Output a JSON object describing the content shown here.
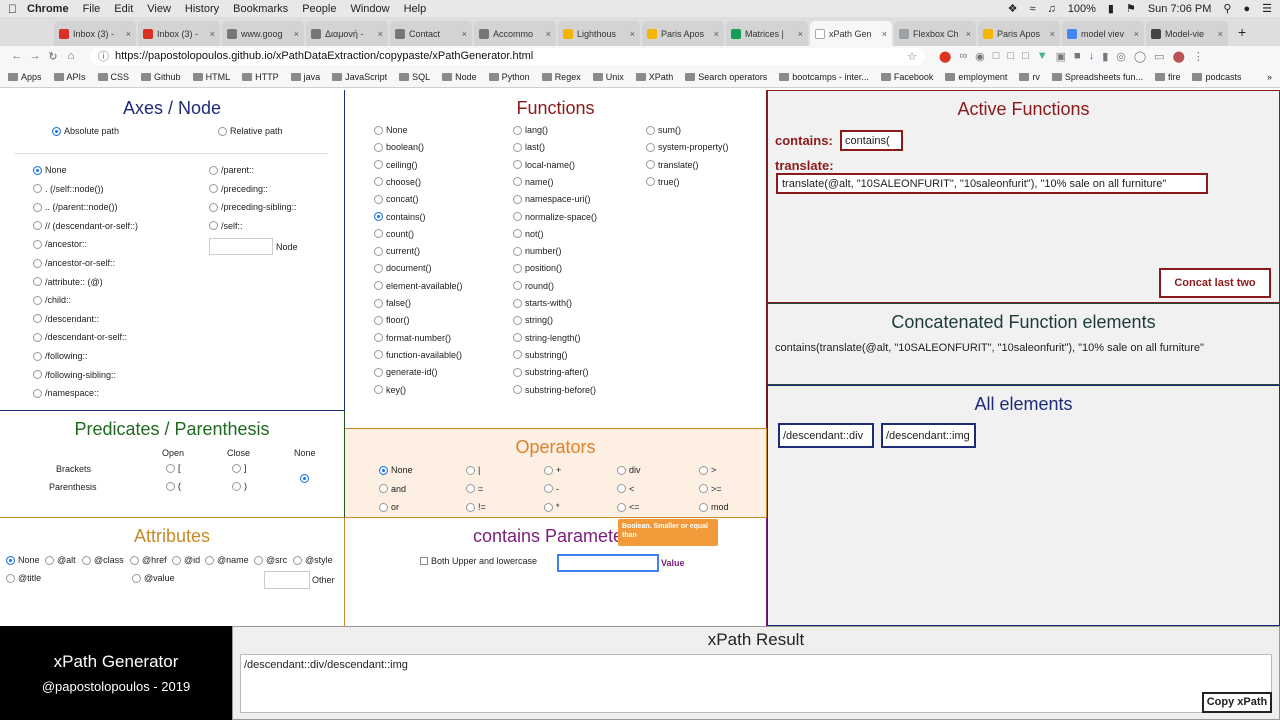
{
  "macbar": {
    "app": "Chrome",
    "menus": [
      "File",
      "Edit",
      "View",
      "History",
      "Bookmarks",
      "People",
      "Window",
      "Help"
    ],
    "battery": "100%",
    "clock": "Sun 7:06 PM"
  },
  "tabs": [
    {
      "label": "Inbox (3) -",
      "color": "#d93025"
    },
    {
      "label": "Inbox (3) -",
      "color": "#d93025"
    },
    {
      "label": "www.goog",
      "color": "#777"
    },
    {
      "label": "Διαμονή - ",
      "color": "#777"
    },
    {
      "label": "Contact",
      "color": "#777"
    },
    {
      "label": "Accommo",
      "color": "#777"
    },
    {
      "label": "Lighthous",
      "color": "#f4b400"
    },
    {
      "label": "Paris Apos",
      "color": "#f4b400"
    },
    {
      "label": "Matrices |",
      "color": "#0f9d58"
    },
    {
      "label": "xPath Gen",
      "color": "#ffffff"
    },
    {
      "label": "Flexbox Ch",
      "color": "#9aa0a6"
    },
    {
      "label": "Paris Apos",
      "color": "#f4b400"
    },
    {
      "label": "model viev",
      "color": "#4285f4"
    },
    {
      "label": "Model-vie",
      "color": "#444"
    }
  ],
  "url": "https://papostolopoulos.github.io/xPathDataExtraction/copypaste/xPathGenerator.html",
  "bookmarks": [
    "Apps",
    "APIs",
    "CSS",
    "Github",
    "HTML",
    "HTTP",
    "java",
    "JavaScript",
    "SQL",
    "Node",
    "Python",
    "Regex",
    "Unix",
    "XPath",
    "Search operators",
    "bootcamps - inter...",
    "Facebook",
    "employment",
    "rv",
    "Spreadsheets fun...",
    "fire",
    "podcasts"
  ],
  "axes": {
    "title": "Axes / Node",
    "abs": "Absolute path",
    "rel": "Relative path",
    "left": [
      "None",
      ". (/self::node())",
      ".. (/parent::node())",
      "// (descendant-or-self::)",
      "/ancestor::",
      "/ancestor-or-self::",
      "/attribute:: (@)",
      "/child::",
      "/descendant::",
      "/descendant-or-self::",
      "/following::",
      "/following-sibling::",
      "/namespace::"
    ],
    "right": [
      "/parent::",
      "/preceding::",
      "/preceding-sibling::",
      "/self::"
    ],
    "node_label": "Node"
  },
  "functions": {
    "title": "Functions",
    "col1": [
      "None",
      "boolean()",
      "ceiling()",
      "choose()",
      "concat()",
      "contains()",
      "count()",
      "current()",
      "document()",
      "element-available()",
      "false()",
      "floor()",
      "format-number()",
      "function-available()",
      "generate-id()",
      "key()"
    ],
    "col2": [
      "lang()",
      "last()",
      "local-name()",
      "name()",
      "namespace-uri()",
      "normalize-space()",
      "not()",
      "number()",
      "position()",
      "round()",
      "starts-with()",
      "string()",
      "string-length()",
      "substring()",
      "substring-after()",
      "substring-before()"
    ],
    "col3": [
      "sum()",
      "system-property()",
      "translate()",
      "true()"
    ]
  },
  "active": {
    "title": "Active Functions",
    "contains_label": "contains:",
    "contains_value": "contains(",
    "translate_label": "translate:",
    "translate_value": "translate(@alt, \"10SALEONFURIT\", \"10saleonfurit\"), \"10% sale on all furniture\"",
    "concat_button": "Concat last two axes"
  },
  "concat": {
    "title": "Concatenated Function elements",
    "value": "contains(translate(@alt, \"10SALEONFURIT\", \"10saleonfurit\"), \"10% sale on all furniture\""
  },
  "all": {
    "title": "All elements",
    "items": [
      "/descendant::div",
      "/descendant::img"
    ]
  },
  "predicates": {
    "title": "Predicates / Parenthesis",
    "open": "Open",
    "close": "Close",
    "none": "None",
    "brackets": "Brackets",
    "parenthesis": "Parenthesis",
    "bo": "[",
    "bc": "]",
    "po": "(",
    "pc": ")"
  },
  "operators": {
    "title": "Operators",
    "rows": [
      [
        "None",
        "|",
        "+",
        "div",
        ">"
      ],
      [
        "and",
        "=",
        "-",
        "<",
        ">="
      ],
      [
        "or",
        "!=",
        "*",
        "<=",
        "mod"
      ]
    ],
    "tooltip": "Boolean. Smaller or equal than"
  },
  "attributes": {
    "title": "Attributes",
    "row1": [
      "None",
      "@alt",
      "@class",
      "@href",
      "@id",
      "@name",
      "@src",
      "@style"
    ],
    "row2": [
      "@title",
      "@value"
    ],
    "other": "Other"
  },
  "params": {
    "title": "contains Parameters",
    "checkbox": "Both Upper and lowercase",
    "value_label": "Value"
  },
  "footer": {
    "app": "xPath Generator",
    "author": "@papostolopoulos - 2019",
    "result_title": "xPath Result",
    "result": "/descendant::div/descendant::img",
    "copy_button": "Copy xPath"
  }
}
